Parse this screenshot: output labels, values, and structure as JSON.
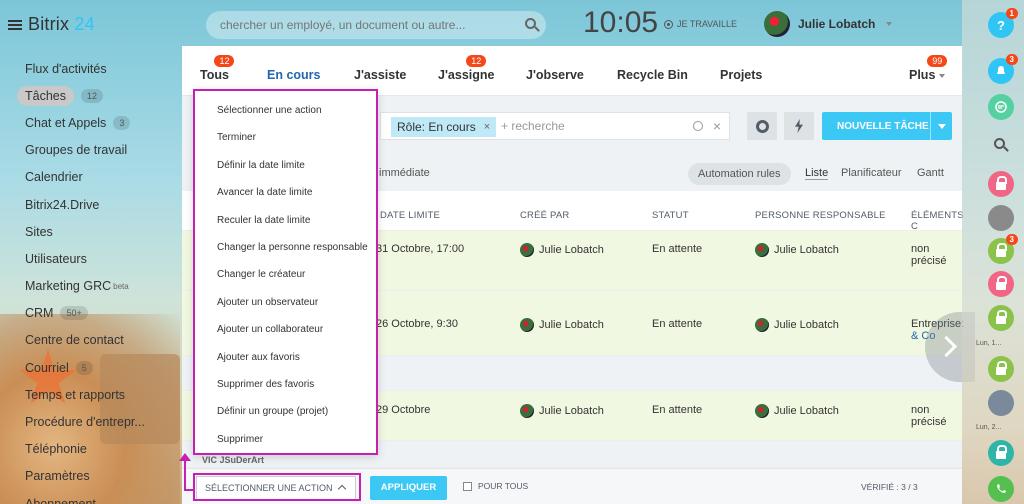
{
  "app": {
    "logo_main": "Bitrix",
    "logo_accent": "24"
  },
  "search": {
    "placeholder": "chercher un employé, un document ou autre..."
  },
  "clock": {
    "time": "10:05",
    "status": "JE TRAVAILLE"
  },
  "user": {
    "name": "Julie Lobatch"
  },
  "sidebar": {
    "items": [
      {
        "label": "Flux d'activités",
        "counter": ""
      },
      {
        "label": "Tâches",
        "counter": "12"
      },
      {
        "label": "Chat et Appels",
        "counter": "3"
      },
      {
        "label": "Groupes de travail",
        "counter": ""
      },
      {
        "label": "Calendrier",
        "counter": ""
      },
      {
        "label": "Bitrix24.Drive",
        "counter": ""
      },
      {
        "label": "Sites",
        "counter": ""
      },
      {
        "label": "Utilisateurs",
        "counter": ""
      },
      {
        "label": "Marketing GRC",
        "counter": "",
        "sup": "beta"
      },
      {
        "label": "CRM",
        "counter": "50+"
      },
      {
        "label": "Centre de contact",
        "counter": ""
      },
      {
        "label": "Courriel",
        "counter": "5"
      },
      {
        "label": "Temps et rapports",
        "counter": ""
      },
      {
        "label": "Procédure d'entrepr...",
        "counter": ""
      },
      {
        "label": "Téléphonie",
        "counter": ""
      },
      {
        "label": "Paramètres",
        "counter": ""
      },
      {
        "label": "Abonnement",
        "counter": ""
      }
    ]
  },
  "tabs": [
    {
      "label": "Tous",
      "badge": "12"
    },
    {
      "label": "En cours",
      "badge": ""
    },
    {
      "label": "J'assiste",
      "badge": ""
    },
    {
      "label": "J'assigne",
      "badge": "12"
    },
    {
      "label": "J'observe",
      "badge": ""
    },
    {
      "label": "Recycle Bin",
      "badge": ""
    },
    {
      "label": "Projets",
      "badge": ""
    },
    {
      "label": "Plus",
      "badge": "99"
    }
  ],
  "filter": {
    "chip": "Rôle: En cours",
    "chip_close": "×",
    "placeholder": "+ recherche",
    "clear": "×"
  },
  "new_task": "NOUVELLE TÂCHE",
  "view": {
    "immediate": "immédiate",
    "automation": "Automation rules",
    "list": "Liste",
    "planner": "Planificateur",
    "gantt": "Gantt"
  },
  "columns": [
    "DATE LIMITE",
    "CRÉÉ PAR",
    "STATUT",
    "PERSONNE RESPONSABLE",
    "ÉLÉMENTS C"
  ],
  "rows": [
    {
      "deadline": "31 Octobre, 17:00",
      "creator": "Julie Lobatch",
      "status": "En attente",
      "responsible": "Julie Lobatch",
      "elements": "non précisé"
    },
    {
      "deadline": "26 Octobre, 9:30",
      "creator": "Julie Lobatch",
      "status": "En attente",
      "responsible": "Julie Lobatch",
      "elements": "Entreprise:",
      "elements_link": "& Co"
    },
    {
      "deadline": "29 Octobre",
      "creator": "Julie Lobatch",
      "status": "En attente",
      "responsible": "Julie Lobatch",
      "elements": "non précisé"
    }
  ],
  "group_label": "VIC JSuDerArt",
  "dropdown": {
    "items": [
      "Sélectionner une action",
      "Terminer",
      "Définir la date limite",
      "Avancer la date limite",
      "Reculer la date limite",
      "Changer la personne responsable",
      "Changer le créateur",
      "Ajouter un observateur",
      "Ajouter un collaborateur",
      "Ajouter aux favoris",
      "Supprimer des favoris",
      "Définir un groupe (projet)",
      "Supprimer"
    ]
  },
  "footer": {
    "select_label": "SÉLECTIONNER UNE ACTION",
    "apply": "APPLIQUER",
    "for_all": "POUR TOUS",
    "verified": "VÉRIFIÉ : 3 / 3"
  },
  "rightbar": {
    "help_badge": "1",
    "notif_badge": "3",
    "lock_badge": "3",
    "label_1": "Lun, 1...",
    "label_2": "Lun, 2..."
  },
  "colors": {
    "accent": "#2fc6f6",
    "highlight": "#c51fb4",
    "button": "#3bc8f5",
    "badge": "#f54819"
  }
}
